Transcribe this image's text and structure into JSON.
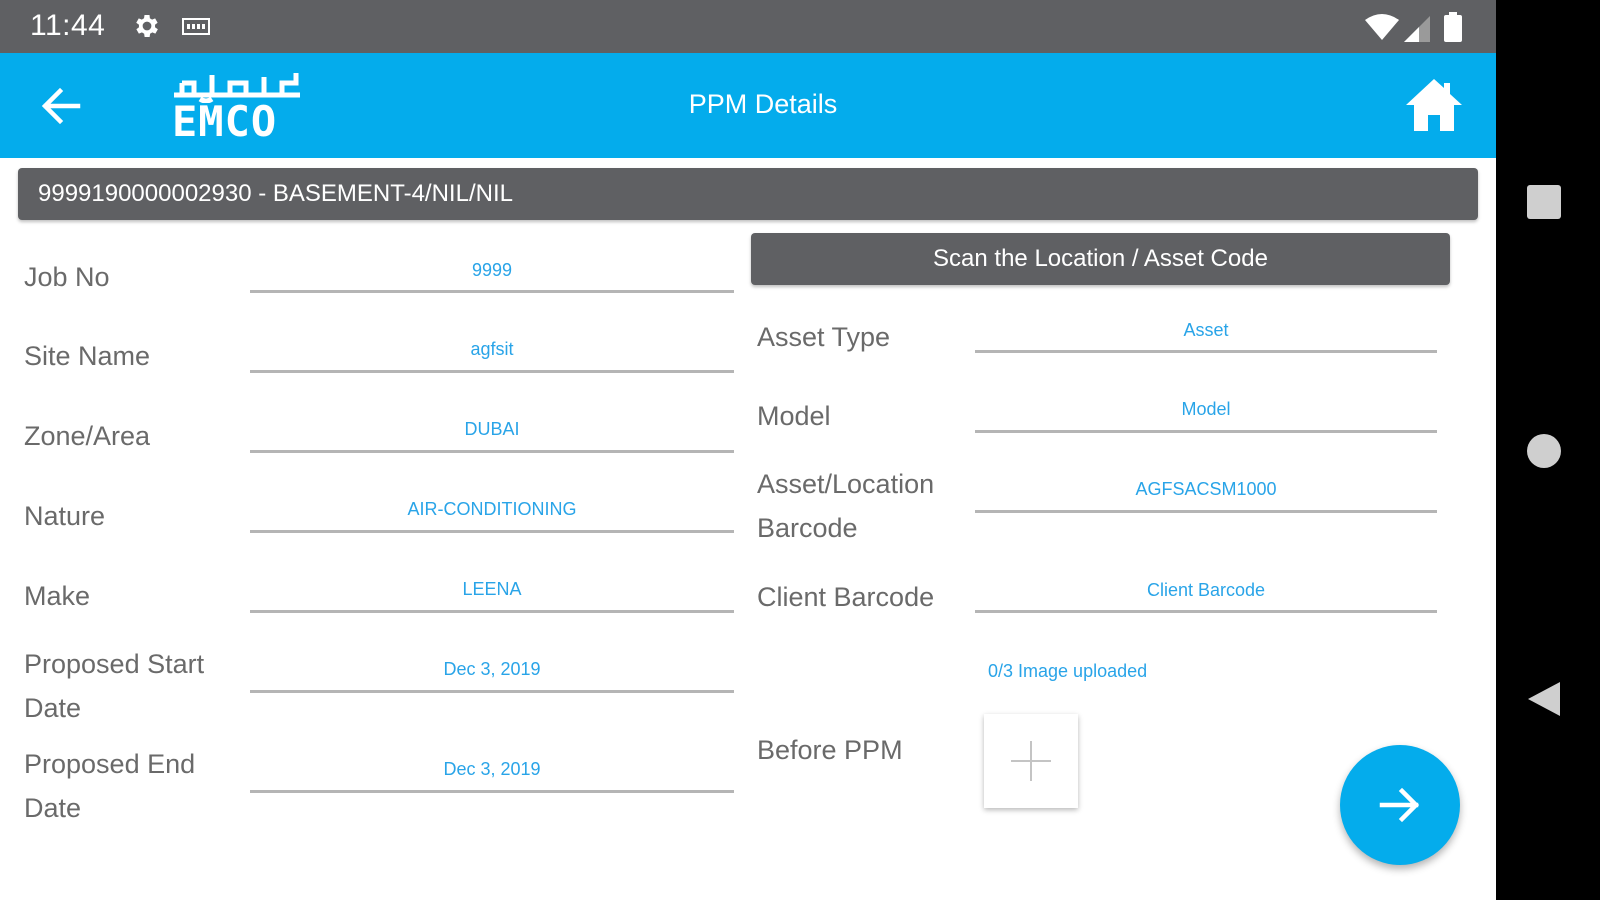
{
  "status_bar": {
    "time": "11:44",
    "icons": [
      "gear-icon",
      "notification-icon",
      "wifi-icon",
      "signal-icon",
      "battery-icon"
    ]
  },
  "app_bar": {
    "title": "PPM Details",
    "logo_text": "EMCO",
    "logo_arabic": "امكو",
    "back_icon": "arrow-left-icon",
    "home_icon": "home-icon",
    "background_color": "#04acec"
  },
  "location": {
    "text": "9999190000002930  -  BASEMENT-4/NIL/NIL"
  },
  "left_fields": [
    {
      "label": "Job No",
      "value": "9999"
    },
    {
      "label": "Site Name",
      "value": "agfsit"
    },
    {
      "label": "Zone/Area",
      "value": "DUBAI"
    },
    {
      "label": "Nature",
      "value": "AIR-CONDITIONING"
    },
    {
      "label": "Make",
      "value": "LEENA"
    },
    {
      "label_line1": "Proposed Start",
      "label_line2": "Date",
      "value": "Dec 3, 2019"
    },
    {
      "label_line1": "Proposed End",
      "label_line2": "Date",
      "value": "Dec 3, 2019"
    }
  ],
  "scan_button": {
    "label": "Scan the Location / Asset Code"
  },
  "right_fields": [
    {
      "label": "Asset Type",
      "value": "Asset"
    },
    {
      "label": "Model",
      "value": "Model"
    },
    {
      "label_line1": "Asset/Location",
      "label_line2": "Barcode",
      "value": "AGFSACSM1000"
    },
    {
      "label": "Client Barcode",
      "value": "Client Barcode"
    }
  ],
  "image_upload": {
    "status": "0/3 Image uploaded",
    "label": "Before PPM",
    "add_icon": "plus-icon"
  },
  "fab": {
    "icon": "arrow-right-icon",
    "color": "#04acec"
  },
  "nav_bar": {
    "icons": [
      "recents-icon",
      "home-circle-icon",
      "back-triangle-icon"
    ]
  }
}
